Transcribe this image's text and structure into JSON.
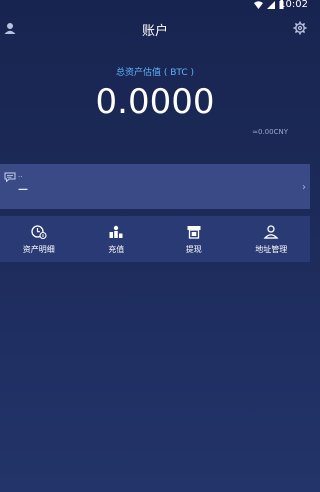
{
  "status_bar": {
    "time": "10:02"
  },
  "header": {
    "title": "账户"
  },
  "asset": {
    "label": "总资产估值 ( BTC )",
    "value": "0.0000",
    "cny": "≈0.00CNY"
  },
  "notice": {
    "title": "..",
    "text": "—",
    "chevron": "›"
  },
  "actions": [
    {
      "label": "资产明细",
      "icon": "clock-coin-icon"
    },
    {
      "label": "充值",
      "icon": "coin-stack-icon"
    },
    {
      "label": "提现",
      "icon": "atm-icon"
    },
    {
      "label": "地址管理",
      "icon": "location-person-icon"
    }
  ],
  "colors": {
    "background": "#1c2a58",
    "accent_blue": "#5fb4ff",
    "notice_bar": "#3a4a87",
    "actions_bar": "#2a3a74"
  }
}
